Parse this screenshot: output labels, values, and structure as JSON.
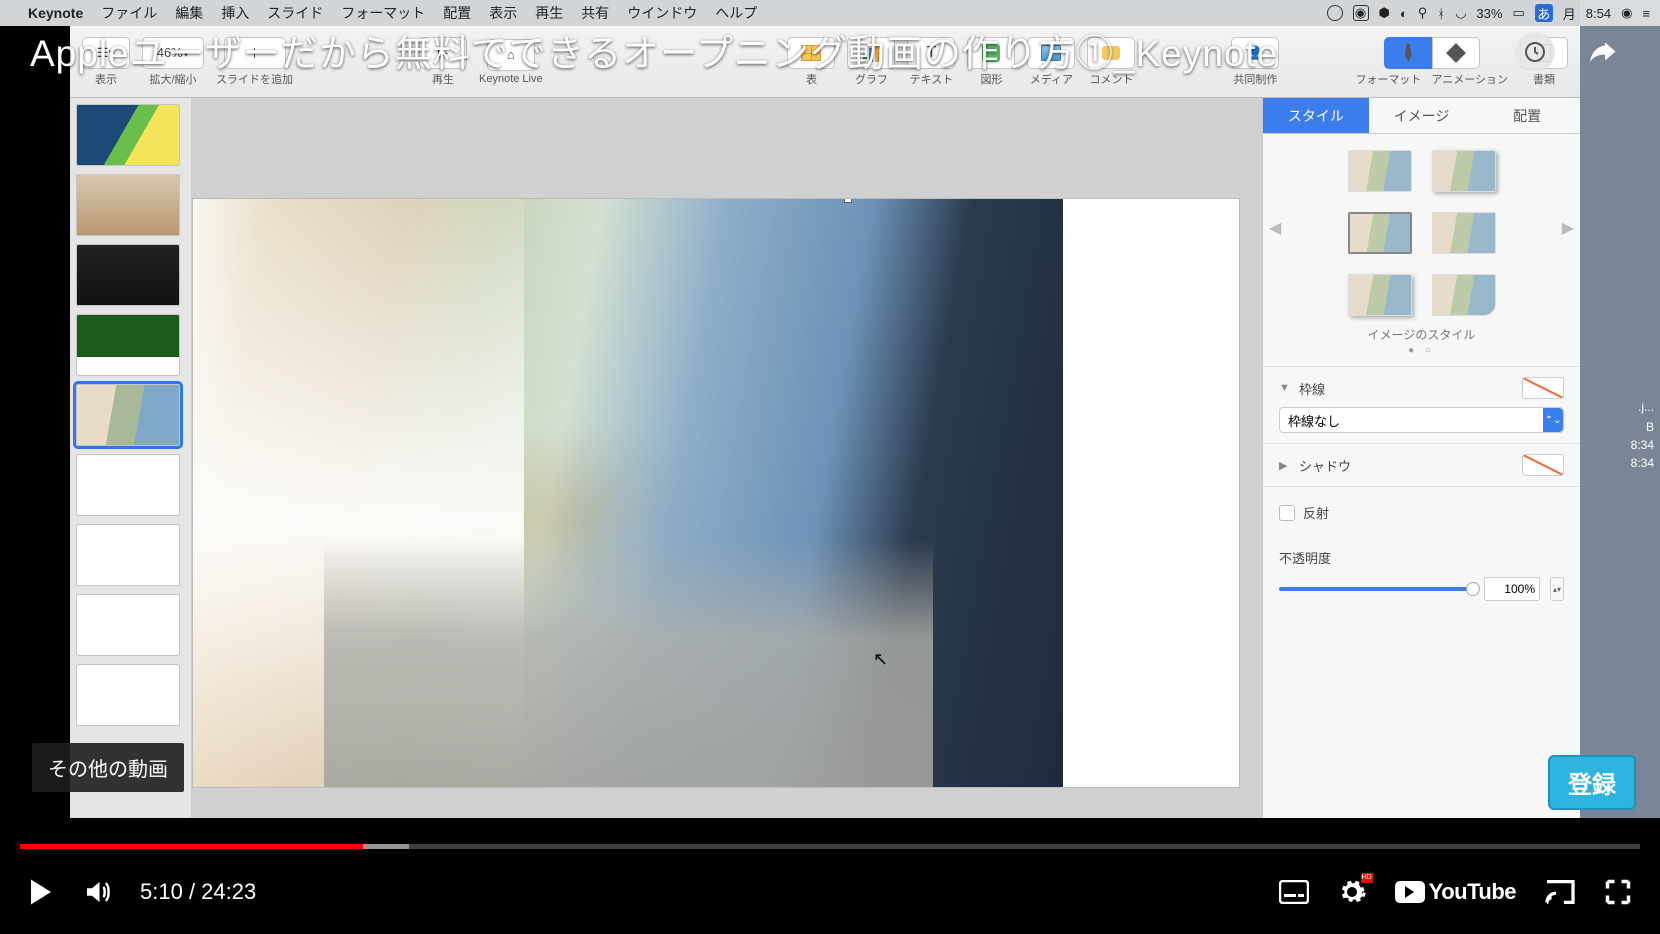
{
  "mac_menu": {
    "app_name": "Keynote",
    "items": [
      "ファイル",
      "編集",
      "挿入",
      "スライド",
      "フォーマット",
      "配置",
      "表示",
      "再生",
      "共有",
      "ウインドウ",
      "ヘルプ"
    ],
    "status": {
      "battery_pct": "33%",
      "ime": "あ",
      "day": "月",
      "time": "8:54"
    }
  },
  "video": {
    "title": "Appleユーザーだから無料でできるオープニング動画の作り方①_Keynote",
    "current_time": "5:10",
    "duration": "24:23",
    "other_videos_tooltip": "その他の動画",
    "subscribe_label": "登録"
  },
  "toolbar": {
    "view_label": "表示",
    "zoom_value": "46%",
    "zoom_label": "拡大/縮小",
    "add_slide_label": "スライドを追加",
    "play_label": "再生",
    "keynote_live_label": "Keynote Live",
    "table_label": "表",
    "chart_label": "グラフ",
    "text_label": "テキスト",
    "shape_label": "図形",
    "media_label": "メディア",
    "comment_label": "コメント",
    "collab_label": "共同制作",
    "format_label": "フォーマット",
    "animation_label": "アニメーション",
    "document_label": "書類"
  },
  "inspector": {
    "tabs": {
      "style": "スタイル",
      "image": "イメージ",
      "arrange": "配置"
    },
    "image_styles_label": "イメージのスタイル",
    "border_section": "枠線",
    "border_value": "枠線なし",
    "shadow_section": "シャドウ",
    "reflection_label": "反射",
    "opacity_label": "不透明度",
    "opacity_value": "100%"
  },
  "desktop": {
    "file_ext": ".j...",
    "size_suffix": "B",
    "time1": "8:34",
    "time2": "8:34"
  },
  "youtube_logo": "YouTube"
}
